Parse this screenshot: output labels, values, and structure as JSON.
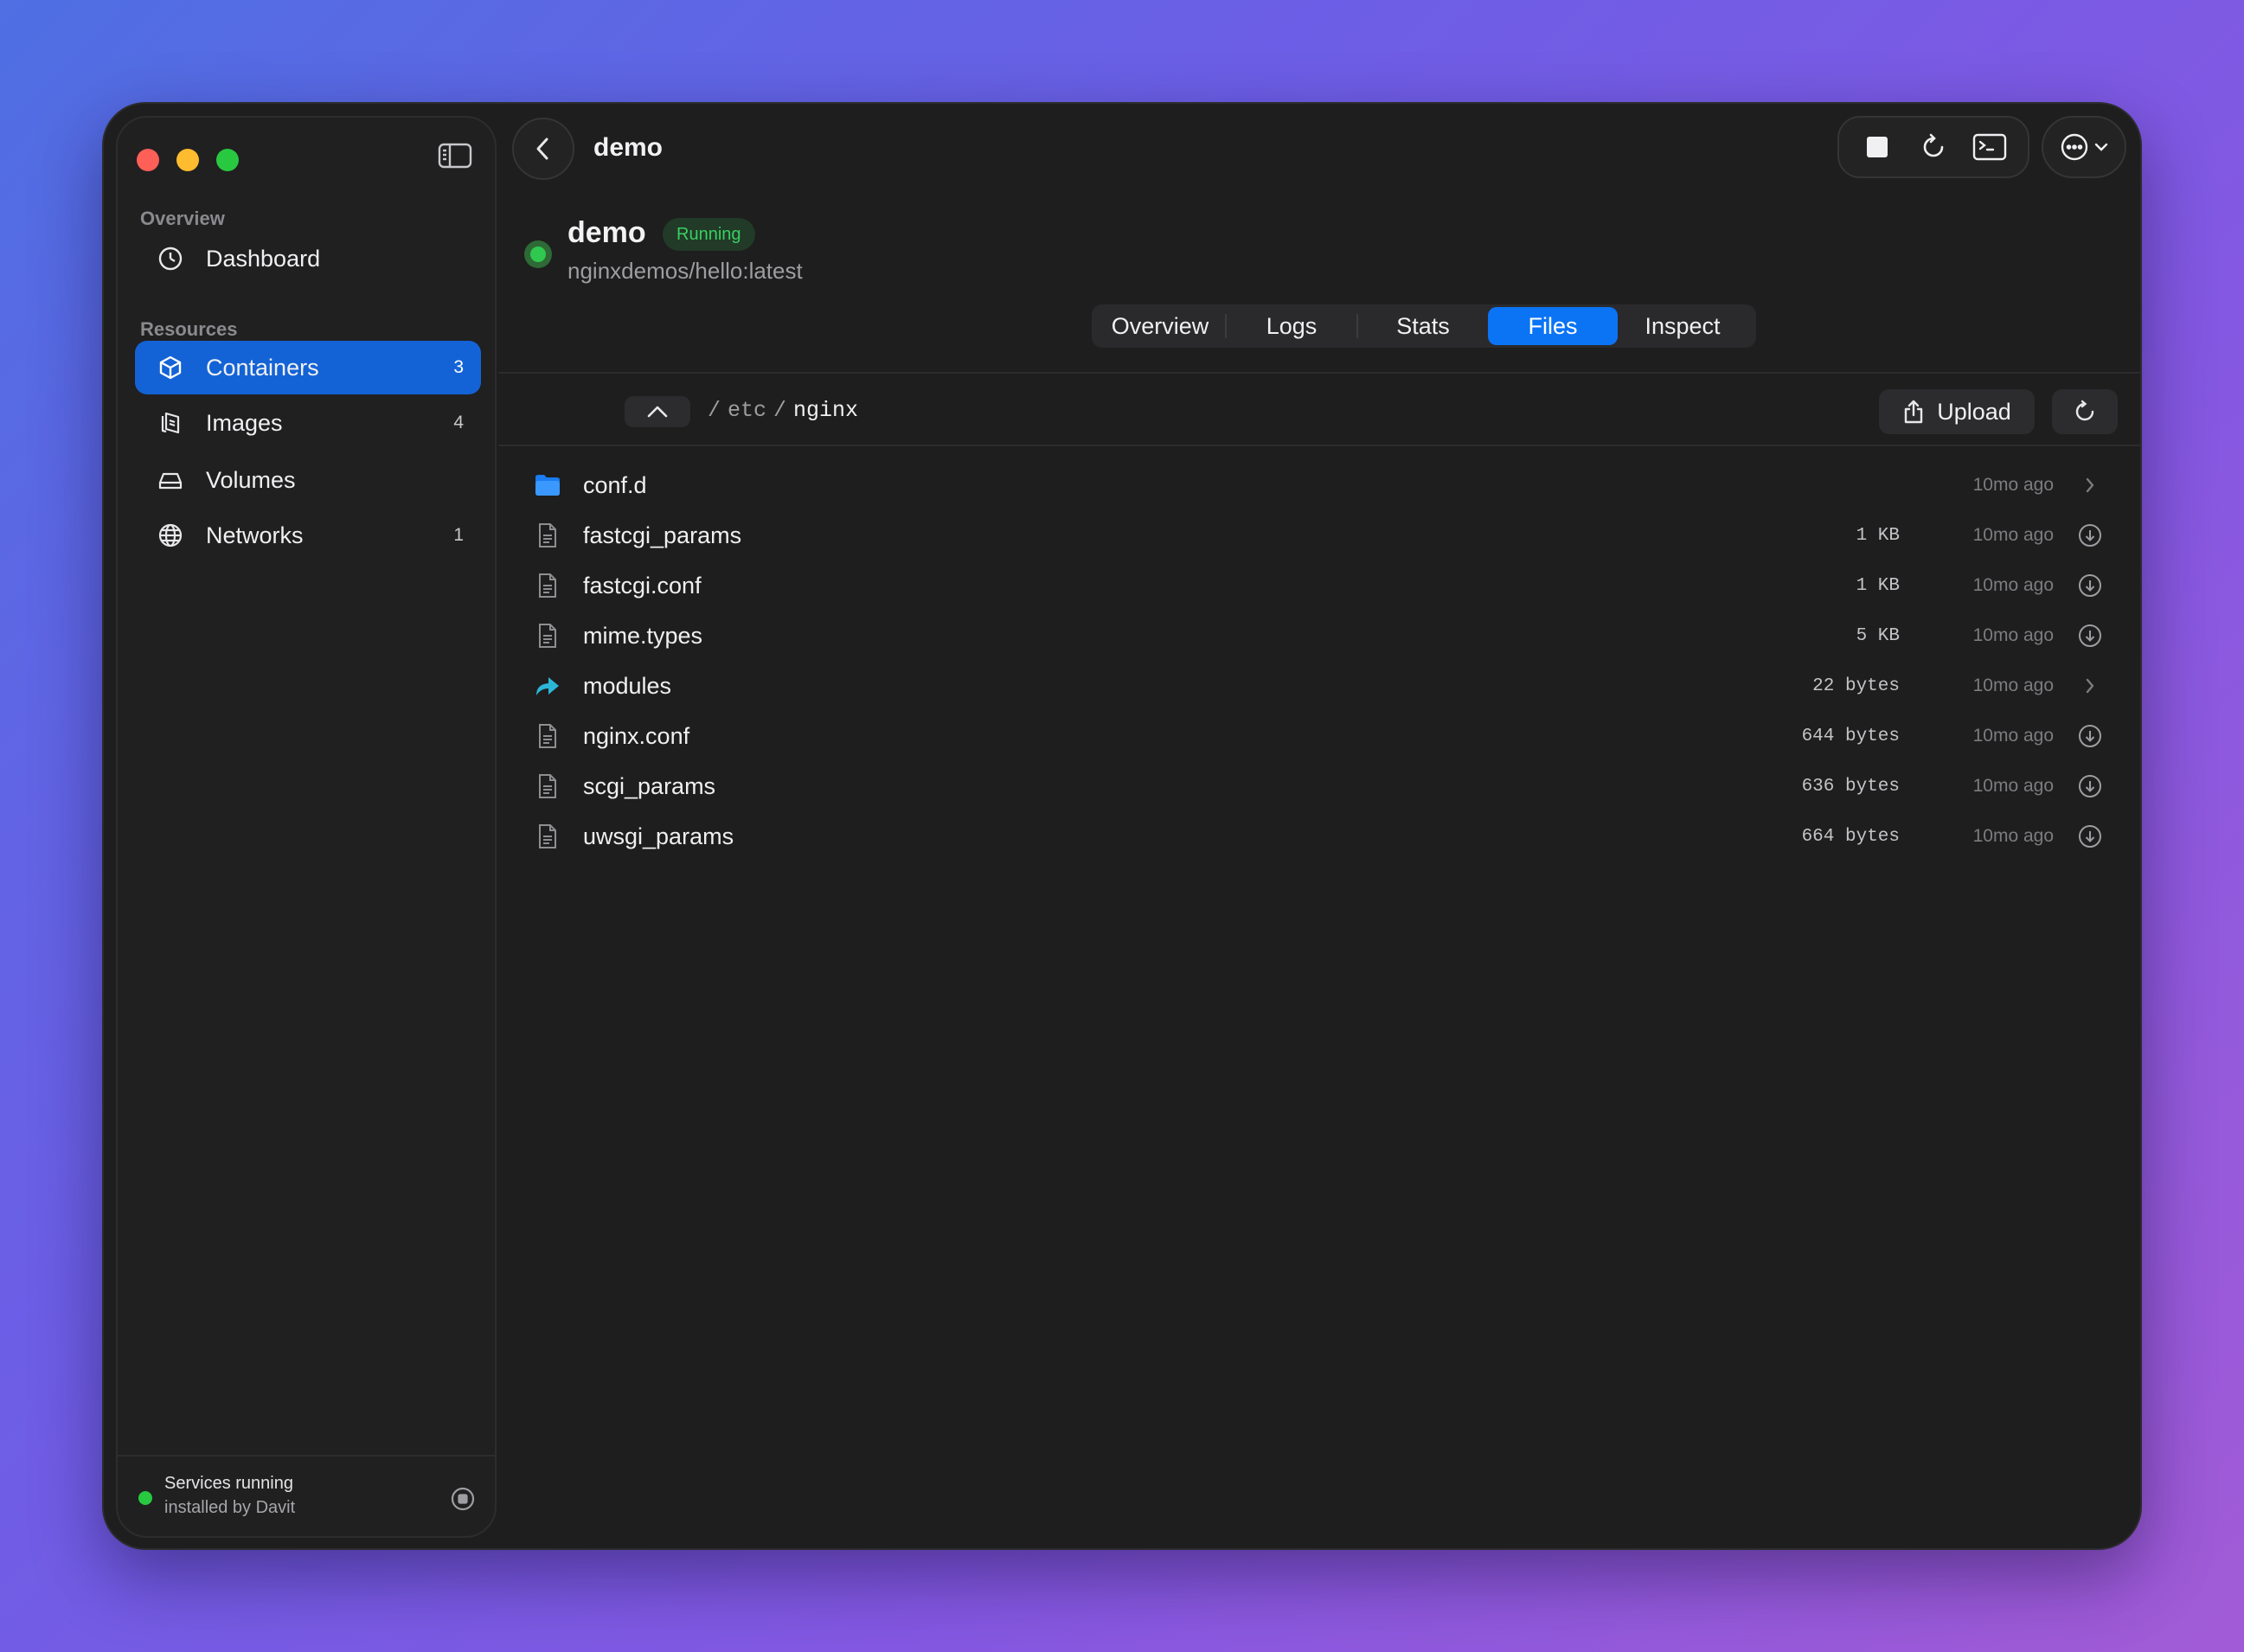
{
  "window": {
    "title": "demo"
  },
  "sidebar": {
    "sections": {
      "overview": "Overview",
      "resources": "Resources"
    },
    "items": [
      {
        "label": "Dashboard",
        "icon": "dashboard-icon",
        "count": ""
      },
      {
        "label": "Containers",
        "icon": "container-icon",
        "count": "3",
        "active": true
      },
      {
        "label": "Images",
        "icon": "images-icon",
        "count": "4"
      },
      {
        "label": "Volumes",
        "icon": "volume-icon",
        "count": ""
      },
      {
        "label": "Networks",
        "icon": "network-icon",
        "count": "1"
      }
    ],
    "footer": {
      "status": "Services running",
      "sub": "installed by Davit"
    }
  },
  "container": {
    "name": "demo",
    "status": "Running",
    "image": "nginxdemos/hello:latest"
  },
  "tabs": [
    {
      "label": "Overview"
    },
    {
      "label": "Logs"
    },
    {
      "label": "Stats"
    },
    {
      "label": "Files",
      "active": true
    },
    {
      "label": "Inspect"
    }
  ],
  "path": {
    "sep": "/",
    "parts": [
      "etc",
      "nginx"
    ]
  },
  "toolbar": {
    "upload_label": "Upload"
  },
  "files": [
    {
      "name": "conf.d",
      "type": "folder",
      "size": "",
      "modified": "10mo ago",
      "action": "chevron"
    },
    {
      "name": "fastcgi_params",
      "type": "file",
      "size": "1 KB",
      "modified": "10mo ago",
      "action": "download"
    },
    {
      "name": "fastcgi.conf",
      "type": "file",
      "size": "1 KB",
      "modified": "10mo ago",
      "action": "download"
    },
    {
      "name": "mime.types",
      "type": "file",
      "size": "5 KB",
      "modified": "10mo ago",
      "action": "download"
    },
    {
      "name": "modules",
      "type": "symlink",
      "size": "22 bytes",
      "modified": "10mo ago",
      "action": "chevron"
    },
    {
      "name": "nginx.conf",
      "type": "file",
      "size": "644 bytes",
      "modified": "10mo ago",
      "action": "download"
    },
    {
      "name": "scgi_params",
      "type": "file",
      "size": "636 bytes",
      "modified": "10mo ago",
      "action": "download"
    },
    {
      "name": "uwsgi_params",
      "type": "file",
      "size": "664 bytes",
      "modified": "10mo ago",
      "action": "download"
    }
  ],
  "colors": {
    "accent": "#0b74f5",
    "sidebar_active": "#1463d6",
    "running": "#30c850"
  }
}
